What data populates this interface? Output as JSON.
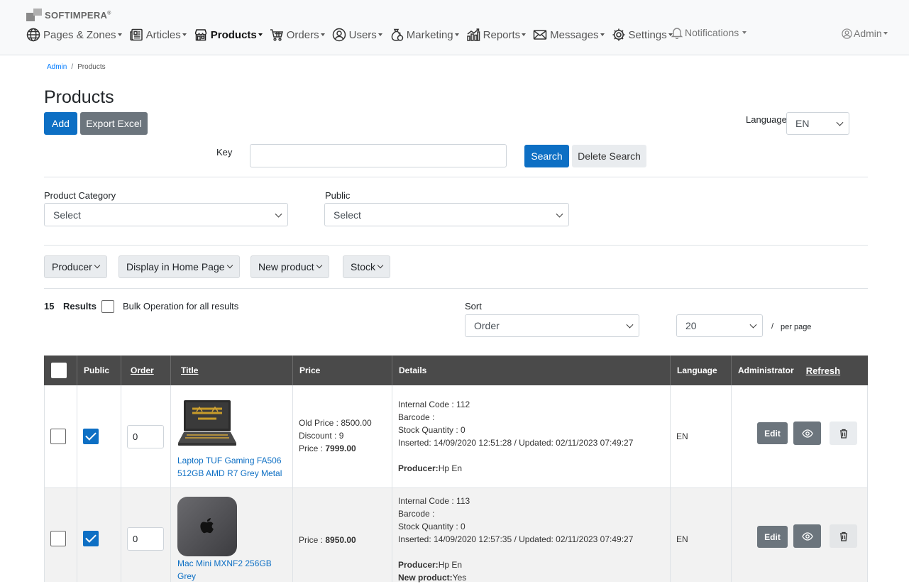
{
  "brand": {
    "name": "SOFTIMPERA",
    "mark": "®"
  },
  "nav": {
    "items": [
      {
        "label": "Pages & Zones",
        "icon": "globe-icon"
      },
      {
        "label": "Articles",
        "icon": "newspaper-icon"
      },
      {
        "label": "Products",
        "icon": "shop-icon",
        "active": true
      },
      {
        "label": "Orders",
        "icon": "cart-icon"
      },
      {
        "label": "Users",
        "icon": "user-circle-icon"
      },
      {
        "label": "Marketing",
        "icon": "money-bag-icon"
      },
      {
        "label": "Reports",
        "icon": "chart-icon"
      },
      {
        "label": "Messages",
        "icon": "envelope-icon"
      },
      {
        "label": "Settings",
        "icon": "gear-icon"
      }
    ],
    "notifications": "Notifications",
    "admin": "Admin"
  },
  "breadcrumb": {
    "root": "Admin",
    "current": "Products"
  },
  "page": {
    "title": "Products"
  },
  "toolbar": {
    "add": "Add",
    "export": "Export Excel"
  },
  "language": {
    "label": "Language",
    "value": "EN"
  },
  "search": {
    "key_label": "Key",
    "value": "",
    "search_btn": "Search",
    "delete_btn": "Delete Search"
  },
  "filters": {
    "category_label": "Product Category",
    "category_value": "Select",
    "public_label": "Public",
    "public_value": "Select",
    "buttons": [
      "Producer",
      "Display in Home Page",
      "New product",
      "Stock"
    ]
  },
  "results": {
    "count": "15",
    "label": "Results",
    "bulk_label": "Bulk Operation for all results",
    "sort_label": "Sort",
    "sort_value": "Order",
    "per_page_value": "20",
    "per_page_label": "per page",
    "slash": "/"
  },
  "table": {
    "headers": {
      "public": "Public",
      "order": "Order",
      "title": "Title",
      "price": "Price",
      "details": "Details",
      "language": "Language",
      "admin": "Administrator",
      "refresh": "Refresh"
    },
    "rows": [
      {
        "public": true,
        "order": "0",
        "title_line1": "Laptop TUF Gaming FA506",
        "title_line2": "512GB AMD R7 Grey Metal",
        "price_lines": [
          "Old Price : 8500.00",
          "Discount : 9"
        ],
        "price_label": "Price : ",
        "price_value": "7999.00",
        "internal_code": "Internal Code : 112",
        "barcode": "Barcode :",
        "stock": "Stock Quantity : 0",
        "dates": "Inserted: 14/09/2020 12:51:28 / Updated: 02/11/2023 07:49:27",
        "producer_label": "Producer:",
        "producer": "Hp En",
        "new_product_label": "",
        "new_product": "",
        "language": "EN",
        "edit": "Edit"
      },
      {
        "public": true,
        "order": "0",
        "title_line1": "Mac Mini MXNF2 256GB",
        "title_line2": "Grey",
        "price_lines": [],
        "price_label": "Price : ",
        "price_value": "8950.00",
        "internal_code": "Internal Code : 113",
        "barcode": "Barcode :",
        "stock": "Stock Quantity : 0",
        "dates": "Inserted: 14/09/2020 12:57:35 / Updated: 02/11/2023 07:49:27",
        "producer_label": "Producer:",
        "producer": "Hp En",
        "new_product_label": "New product:",
        "new_product": "Yes",
        "language": "EN",
        "edit": "Edit"
      }
    ]
  },
  "colors": {
    "primary": "#0d6fc4",
    "header_bg": "#4a4a4a",
    "secondary": "#6c757d"
  }
}
